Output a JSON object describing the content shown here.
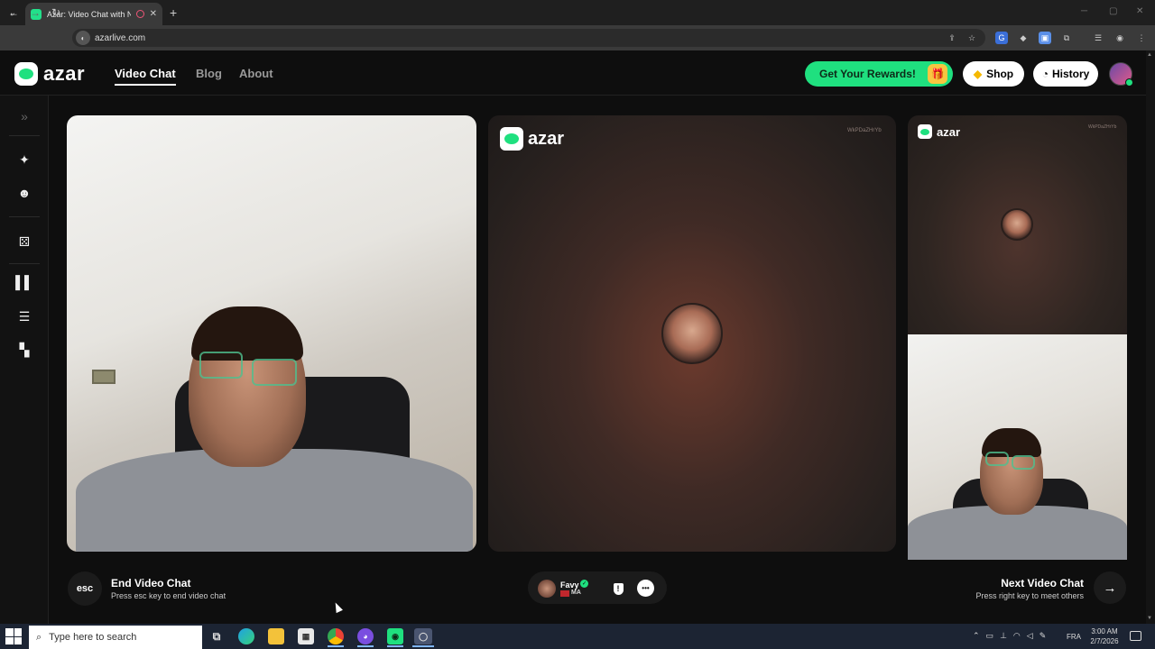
{
  "browser": {
    "tab_title": "Azar: Video Chat with New",
    "tab_close": "✕",
    "new_tab": "+",
    "url": "azarlive.com",
    "window_controls": [
      "─",
      "▢",
      "✕"
    ],
    "nav_icons": [
      "arrow-left-icon",
      "arrow-right-icon",
      "reload-icon"
    ]
  },
  "header": {
    "logo_text": "azar",
    "nav": [
      "Video Chat",
      "Blog",
      "About"
    ],
    "rewards_label": "Get Your Rewards!",
    "shop_label": "Shop",
    "history_label": "History",
    "accent": "#1fe07f"
  },
  "sidebar": {
    "icons": [
      "expand-icon",
      "magic-wand-icon",
      "face-filter-icon",
      "random-icon",
      "layout-columns-icon",
      "layout-rows-icon",
      "layout-grid-icon"
    ]
  },
  "video": {
    "watermark_logo": "azar",
    "watermark_id": "WkPDaZHrYb"
  },
  "controls": {
    "esc_key": "esc",
    "end_title": "End Video Chat",
    "end_subtitle": "Press esc key to end video chat",
    "partner_name": "Favy",
    "partner_country": "MA",
    "next_title": "Next Video Chat",
    "next_subtitle": "Press right key to meet others"
  },
  "taskbar": {
    "search_placeholder": "Type here to search",
    "language": "FRA",
    "time": "3:00 AM",
    "date": "2/7/2026"
  }
}
